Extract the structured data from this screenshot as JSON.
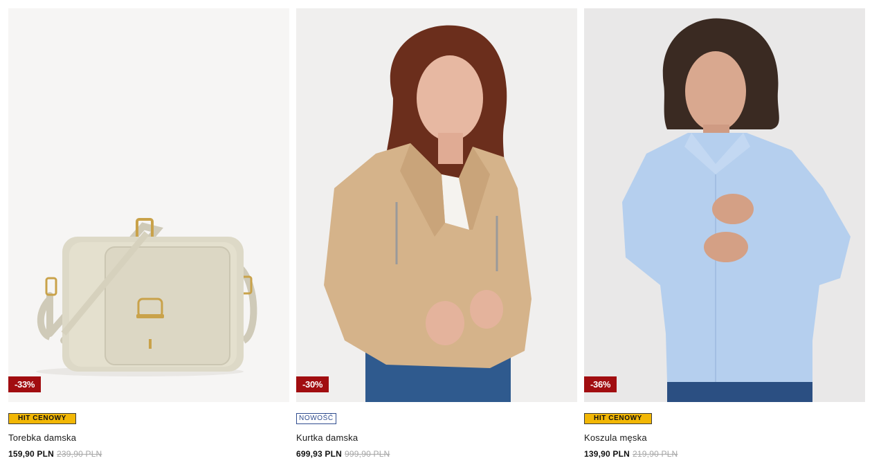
{
  "colors": {
    "discount_badge": "#a10d10",
    "hit_badge": "#f2b705",
    "new_badge_border": "#2f4c8f",
    "old_price": "#a6a6a6"
  },
  "products": [
    {
      "image": "beige-crossbody-bag-photo",
      "discount": "-33%",
      "badge": "HIT CENOWY",
      "name": "Torebka damska",
      "price": "159,90 PLN",
      "old_price": "239,90 PLN"
    },
    {
      "image": "woman-beige-leather-jacket-photo",
      "discount": "-30%",
      "badge": "NOWOŚĆ",
      "name": "Kurtka damska",
      "price": "699,93 PLN",
      "old_price": "999,90 PLN"
    },
    {
      "image": "man-blue-checked-shirt-photo",
      "discount": "-36%",
      "badge": "HIT CENOWY",
      "name": "Koszula męska",
      "price": "139,90 PLN",
      "old_price": "219,90 PLN"
    }
  ]
}
